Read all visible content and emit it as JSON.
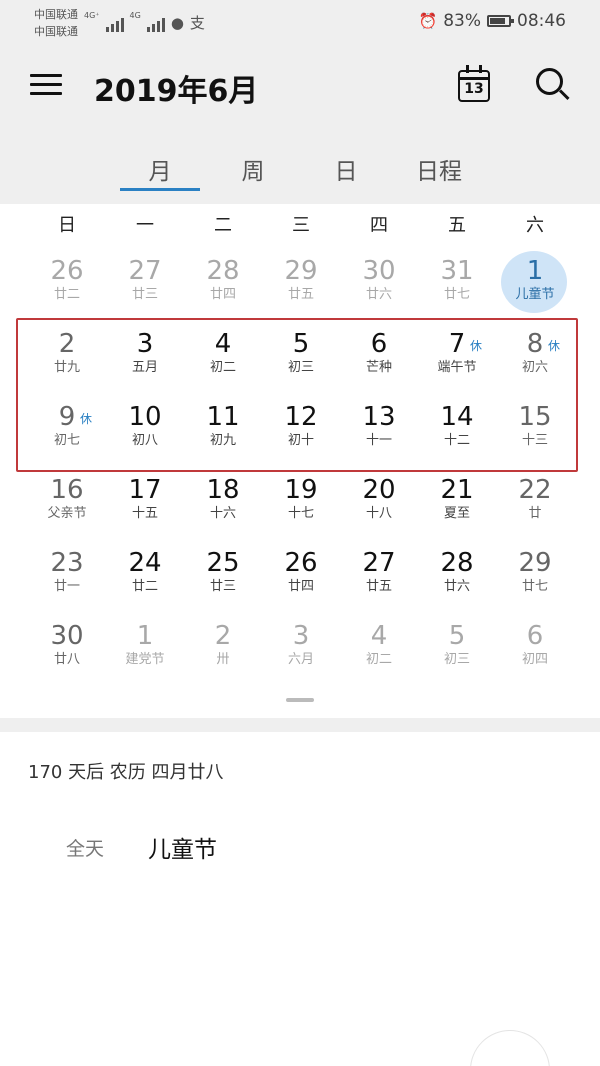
{
  "status_bar": {
    "carrier1": "中国联通",
    "carrier2": "中国联通",
    "net1": "4G⁺",
    "net2": "4G",
    "battery_percent": "83%",
    "battery_level": 0.83,
    "time": "08:46"
  },
  "app_bar": {
    "title": "2019年6月",
    "today_icon_day": "13"
  },
  "tabs": [
    {
      "label": "月",
      "active": true
    },
    {
      "label": "周",
      "active": false
    },
    {
      "label": "日",
      "active": false
    },
    {
      "label": "日程",
      "active": false
    }
  ],
  "weekdays": [
    "日",
    "一",
    "二",
    "三",
    "四",
    "五",
    "六"
  ],
  "weeks": [
    [
      {
        "day": "26",
        "lunar": "廿二",
        "state": "dim"
      },
      {
        "day": "27",
        "lunar": "廿三",
        "state": "dim"
      },
      {
        "day": "28",
        "lunar": "廿四",
        "state": "dim"
      },
      {
        "day": "29",
        "lunar": "廿五",
        "state": "dim"
      },
      {
        "day": "30",
        "lunar": "廿六",
        "state": "dim"
      },
      {
        "day": "31",
        "lunar": "廿七",
        "state": "dim"
      },
      {
        "day": "1",
        "lunar": "儿童节",
        "state": "selected"
      }
    ],
    [
      {
        "day": "2",
        "lunar": "廿九",
        "state": "weekend"
      },
      {
        "day": "3",
        "lunar": "五月",
        "state": "normal"
      },
      {
        "day": "4",
        "lunar": "初二",
        "state": "normal"
      },
      {
        "day": "5",
        "lunar": "初三",
        "state": "normal"
      },
      {
        "day": "6",
        "lunar": "芒种",
        "state": "normal"
      },
      {
        "day": "7",
        "lunar": "端午节",
        "state": "normal",
        "tag": "休"
      },
      {
        "day": "8",
        "lunar": "初六",
        "state": "weekend",
        "tag": "休"
      }
    ],
    [
      {
        "day": "9",
        "lunar": "初七",
        "state": "weekend",
        "tag": "休"
      },
      {
        "day": "10",
        "lunar": "初八",
        "state": "normal"
      },
      {
        "day": "11",
        "lunar": "初九",
        "state": "normal"
      },
      {
        "day": "12",
        "lunar": "初十",
        "state": "normal"
      },
      {
        "day": "13",
        "lunar": "十一",
        "state": "normal"
      },
      {
        "day": "14",
        "lunar": "十二",
        "state": "normal"
      },
      {
        "day": "15",
        "lunar": "十三",
        "state": "weekend"
      }
    ],
    [
      {
        "day": "16",
        "lunar": "父亲节",
        "state": "weekend"
      },
      {
        "day": "17",
        "lunar": "十五",
        "state": "normal"
      },
      {
        "day": "18",
        "lunar": "十六",
        "state": "normal"
      },
      {
        "day": "19",
        "lunar": "十七",
        "state": "normal"
      },
      {
        "day": "20",
        "lunar": "十八",
        "state": "normal"
      },
      {
        "day": "21",
        "lunar": "夏至",
        "state": "normal"
      },
      {
        "day": "22",
        "lunar": "廿",
        "state": "weekend"
      }
    ],
    [
      {
        "day": "23",
        "lunar": "廿一",
        "state": "weekend"
      },
      {
        "day": "24",
        "lunar": "廿二",
        "state": "normal"
      },
      {
        "day": "25",
        "lunar": "廿三",
        "state": "normal"
      },
      {
        "day": "26",
        "lunar": "廿四",
        "state": "normal"
      },
      {
        "day": "27",
        "lunar": "廿五",
        "state": "normal"
      },
      {
        "day": "28",
        "lunar": "廿六",
        "state": "normal"
      },
      {
        "day": "29",
        "lunar": "廿七",
        "state": "weekend"
      }
    ],
    [
      {
        "day": "30",
        "lunar": "廿八",
        "state": "weekend"
      },
      {
        "day": "1",
        "lunar": "建党节",
        "state": "dim"
      },
      {
        "day": "2",
        "lunar": "卅",
        "state": "dim"
      },
      {
        "day": "3",
        "lunar": "六月",
        "state": "dim"
      },
      {
        "day": "4",
        "lunar": "初二",
        "state": "dim"
      },
      {
        "day": "5",
        "lunar": "初三",
        "state": "dim"
      },
      {
        "day": "6",
        "lunar": "初四",
        "state": "dim"
      }
    ]
  ],
  "detail": {
    "countdown": "170 天后  农历 四月廿八",
    "event_time": "全天",
    "event_name": "儿童节"
  },
  "colors": {
    "accent": "#2a80c3",
    "highlight_border": "#c0393b",
    "selected_bg": "#cfe4f7"
  }
}
